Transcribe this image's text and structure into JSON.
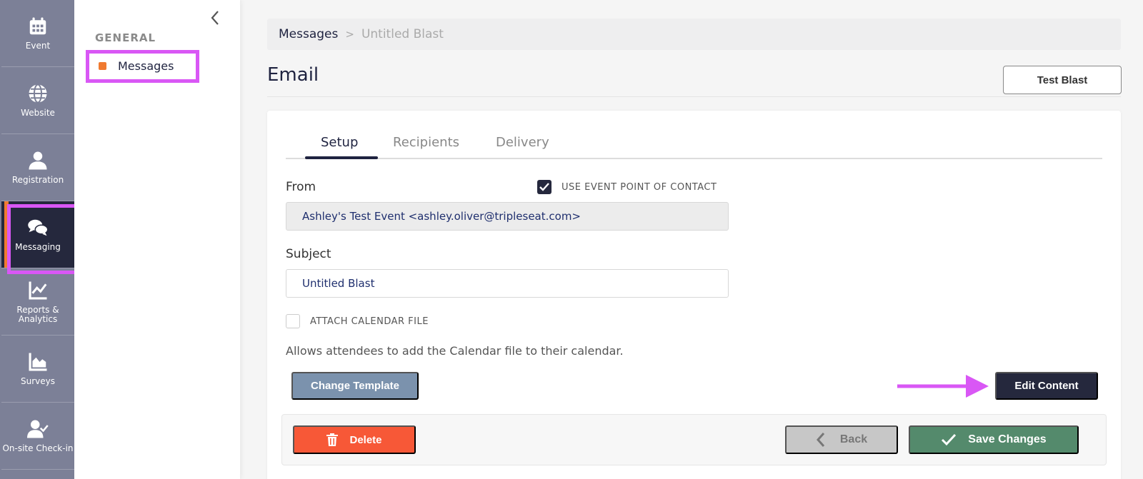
{
  "rail": {
    "items": [
      {
        "label": "Event",
        "icon": "calendar-icon"
      },
      {
        "label": "Website",
        "icon": "globe-icon"
      },
      {
        "label": "Registration",
        "icon": "person-icon"
      },
      {
        "label": "Messaging",
        "icon": "chat-bubbles-icon"
      },
      {
        "label": "Reports & Analytics",
        "icon": "line-chart-icon"
      },
      {
        "label": "Surveys",
        "icon": "area-chart-icon"
      },
      {
        "label": "On-site Check-in",
        "icon": "person-check-icon"
      }
    ],
    "active_index": 3
  },
  "sidebar": {
    "section_title": "GENERAL",
    "items": [
      {
        "label": "Messages"
      }
    ]
  },
  "breadcrumb": {
    "parent": "Messages",
    "separator": ">",
    "current": "Untitled Blast"
  },
  "header": {
    "title": "Email",
    "test_button": "Test Blast"
  },
  "tabs": [
    {
      "label": "Setup"
    },
    {
      "label": "Recipients"
    },
    {
      "label": "Delivery"
    }
  ],
  "form": {
    "from_label": "From",
    "use_contact_label": "USE EVENT POINT OF CONTACT",
    "use_contact_checked": true,
    "from_value": "Ashley's Test Event <ashley.oliver@tripleseat.com>",
    "subject_label": "Subject",
    "subject_value": "Untitled Blast",
    "attach_label": "ATTACH CALENDAR FILE",
    "attach_checked": false,
    "help_text": "Allows attendees to add the Calendar file to their calendar."
  },
  "buttons": {
    "change_template": "Change Template",
    "edit_content": "Edit Content",
    "delete": "Delete",
    "back": "Back",
    "save": "Save Changes"
  },
  "colors": {
    "accent": "#f07a30",
    "highlight": "#d957f5",
    "dark": "#25283d",
    "danger": "#f75837",
    "success": "#548a6c"
  }
}
